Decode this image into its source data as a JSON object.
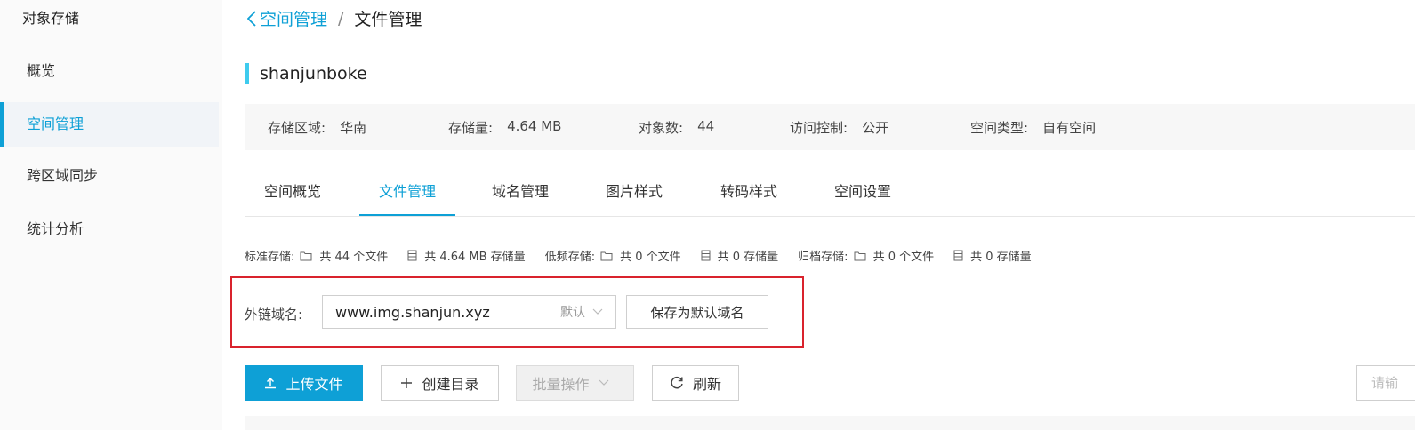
{
  "sidebar": {
    "title": "对象存储",
    "items": [
      {
        "label": "概览"
      },
      {
        "label": "空间管理"
      },
      {
        "label": "跨区域同步"
      },
      {
        "label": "统计分析"
      }
    ],
    "active_index": 1
  },
  "breadcrumb": {
    "parent": "空间管理",
    "separator": "/",
    "current": "文件管理"
  },
  "bucket": {
    "name": "shanjunboke"
  },
  "info": {
    "region_label": "存储区域:",
    "region_value": "华南",
    "size_label": "存储量:",
    "size_value": "4.64 MB",
    "objects_label": "对象数:",
    "objects_value": "44",
    "acl_label": "访问控制:",
    "acl_value": "公开",
    "type_label": "空间类型:",
    "type_value": "自有空间"
  },
  "tabs": [
    {
      "label": "空间概览"
    },
    {
      "label": "文件管理"
    },
    {
      "label": "域名管理"
    },
    {
      "label": "图片样式"
    },
    {
      "label": "转码样式"
    },
    {
      "label": "空间设置"
    }
  ],
  "active_tab": 1,
  "stats": {
    "standard_label": "标准存储:",
    "standard_files": "共 44 个文件",
    "standard_size": "共 4.64 MB 存储量",
    "infrequent_label": "低频存储:",
    "infrequent_files": "共 0 个文件",
    "infrequent_size": "共 0 存储量",
    "archive_label": "归档存储:",
    "archive_files": "共 0 个文件",
    "archive_size": "共 0 存储量"
  },
  "domain": {
    "label": "外链域名:",
    "value": "www.img.shanjun.xyz",
    "tag": "默认",
    "save_button": "保存为默认域名"
  },
  "toolbar": {
    "upload": "上传文件",
    "mkdir": "创建目录",
    "batch": "批量操作",
    "refresh": "刷新",
    "search_placeholder": "请输"
  },
  "colors": {
    "accent": "#0ea0d6",
    "highlight_border": "#d9232d",
    "bucket_bar": "#3ecbee"
  }
}
